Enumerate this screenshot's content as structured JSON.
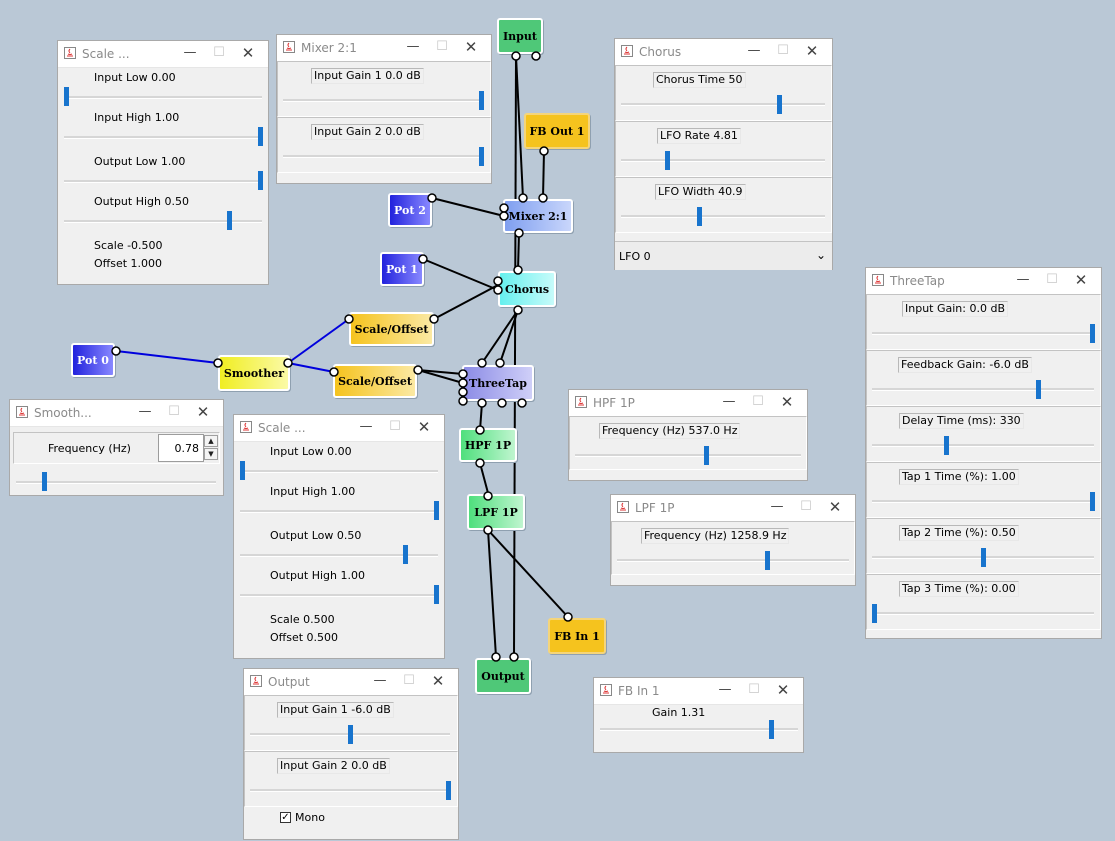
{
  "blocks": {
    "input": "Input",
    "fb_out_1": "FB Out 1",
    "mixer": "Mixer 2:1",
    "pot2": "Pot 2",
    "pot1": "Pot 1",
    "pot0": "Pot 0",
    "chorus": "Chorus",
    "scale_offset_a": "Scale/Offset",
    "scale_offset_b": "Scale/Offset",
    "smoother": "Smoother",
    "threetap": "ThreeTap",
    "hpf": "HPF 1P",
    "lpf": "LPF 1P",
    "fb_in_1": "FB In 1",
    "output": "Output"
  },
  "windows": {
    "scale1": {
      "title": "Scale ...",
      "input_low": "Input Low 0.00",
      "input_high": "Input High 1.00",
      "output_low": "Output Low 1.00",
      "output_high": "Output High 0.50",
      "scale": "Scale -0.500",
      "offset": "Offset 1.000",
      "input_low_level": 0.0,
      "input_high_level": 1.0,
      "output_low_level": 1.0,
      "output_high_level": 0.84
    },
    "mixer": {
      "title": "Mixer 2:1",
      "gain1": "Input Gain 1  0.0 dB",
      "gain2": "Input Gain 2  0.0 dB",
      "gain1_level": 1.0,
      "gain2_level": 1.0
    },
    "chorus": {
      "title": "Chorus",
      "time": "Chorus Time   50",
      "rate": "LFO Rate 4.81",
      "width": "LFO Width 40.9",
      "lfo": "LFO 0",
      "time_level": 0.78,
      "rate_level": 0.22,
      "width_level": 0.38
    },
    "threetap": {
      "title": "ThreeTap",
      "input_gain": "Input Gain:   0.0 dB",
      "feedback_gain": "Feedback Gain:  -6.0 dB",
      "delay_time": "Delay Time (ms):   330",
      "tap1": "Tap 1 Time (%):  1.00",
      "tap2": "Tap 2 Time (%):  0.50",
      "tap3": "Tap 3 Time (%):  0.00",
      "input_gain_level": 1.0,
      "feedback_gain_level": 0.75,
      "delay_time_level": 0.33,
      "tap1_level": 1.0,
      "tap2_level": 0.5,
      "tap3_level": 0.0
    },
    "smoother": {
      "title": "Smooth...",
      "freq_label": "Frequency (Hz)",
      "freq_value": "0.78",
      "freq_level": 0.13
    },
    "scale2": {
      "title": "Scale ...",
      "input_low": "Input Low 0.00",
      "input_high": "Input High 1.00",
      "output_low": "Output Low 0.50",
      "output_high": "Output High 1.00",
      "scale": "Scale 0.500",
      "offset": "Offset 0.500",
      "input_low_level": 0.0,
      "input_high_level": 1.0,
      "output_low_level": 0.84,
      "output_high_level": 1.0
    },
    "hpf": {
      "title": "HPF 1P",
      "freq": "Frequency (Hz) 537.0 Hz",
      "freq_level": 0.58
    },
    "lpf": {
      "title": "LPF 1P",
      "freq": "Frequency (Hz) 1258.9 Hz",
      "freq_level": 0.65
    },
    "output": {
      "title": "Output",
      "gain1": "Input Gain 1 -6.0 dB",
      "gain2": "Input Gain 2  0.0 dB",
      "mono": "Mono",
      "mono_checked": true,
      "gain1_level": 0.5,
      "gain2_level": 1.0
    },
    "fbin": {
      "title": "FB In 1",
      "gain": "Gain 1.31",
      "gain_level": 0.87
    }
  },
  "colors": {
    "desktop": "#bac8d6",
    "slider_thumb": "#1874cd",
    "wire_default": "#000000",
    "wire_control": "#0000dd"
  }
}
